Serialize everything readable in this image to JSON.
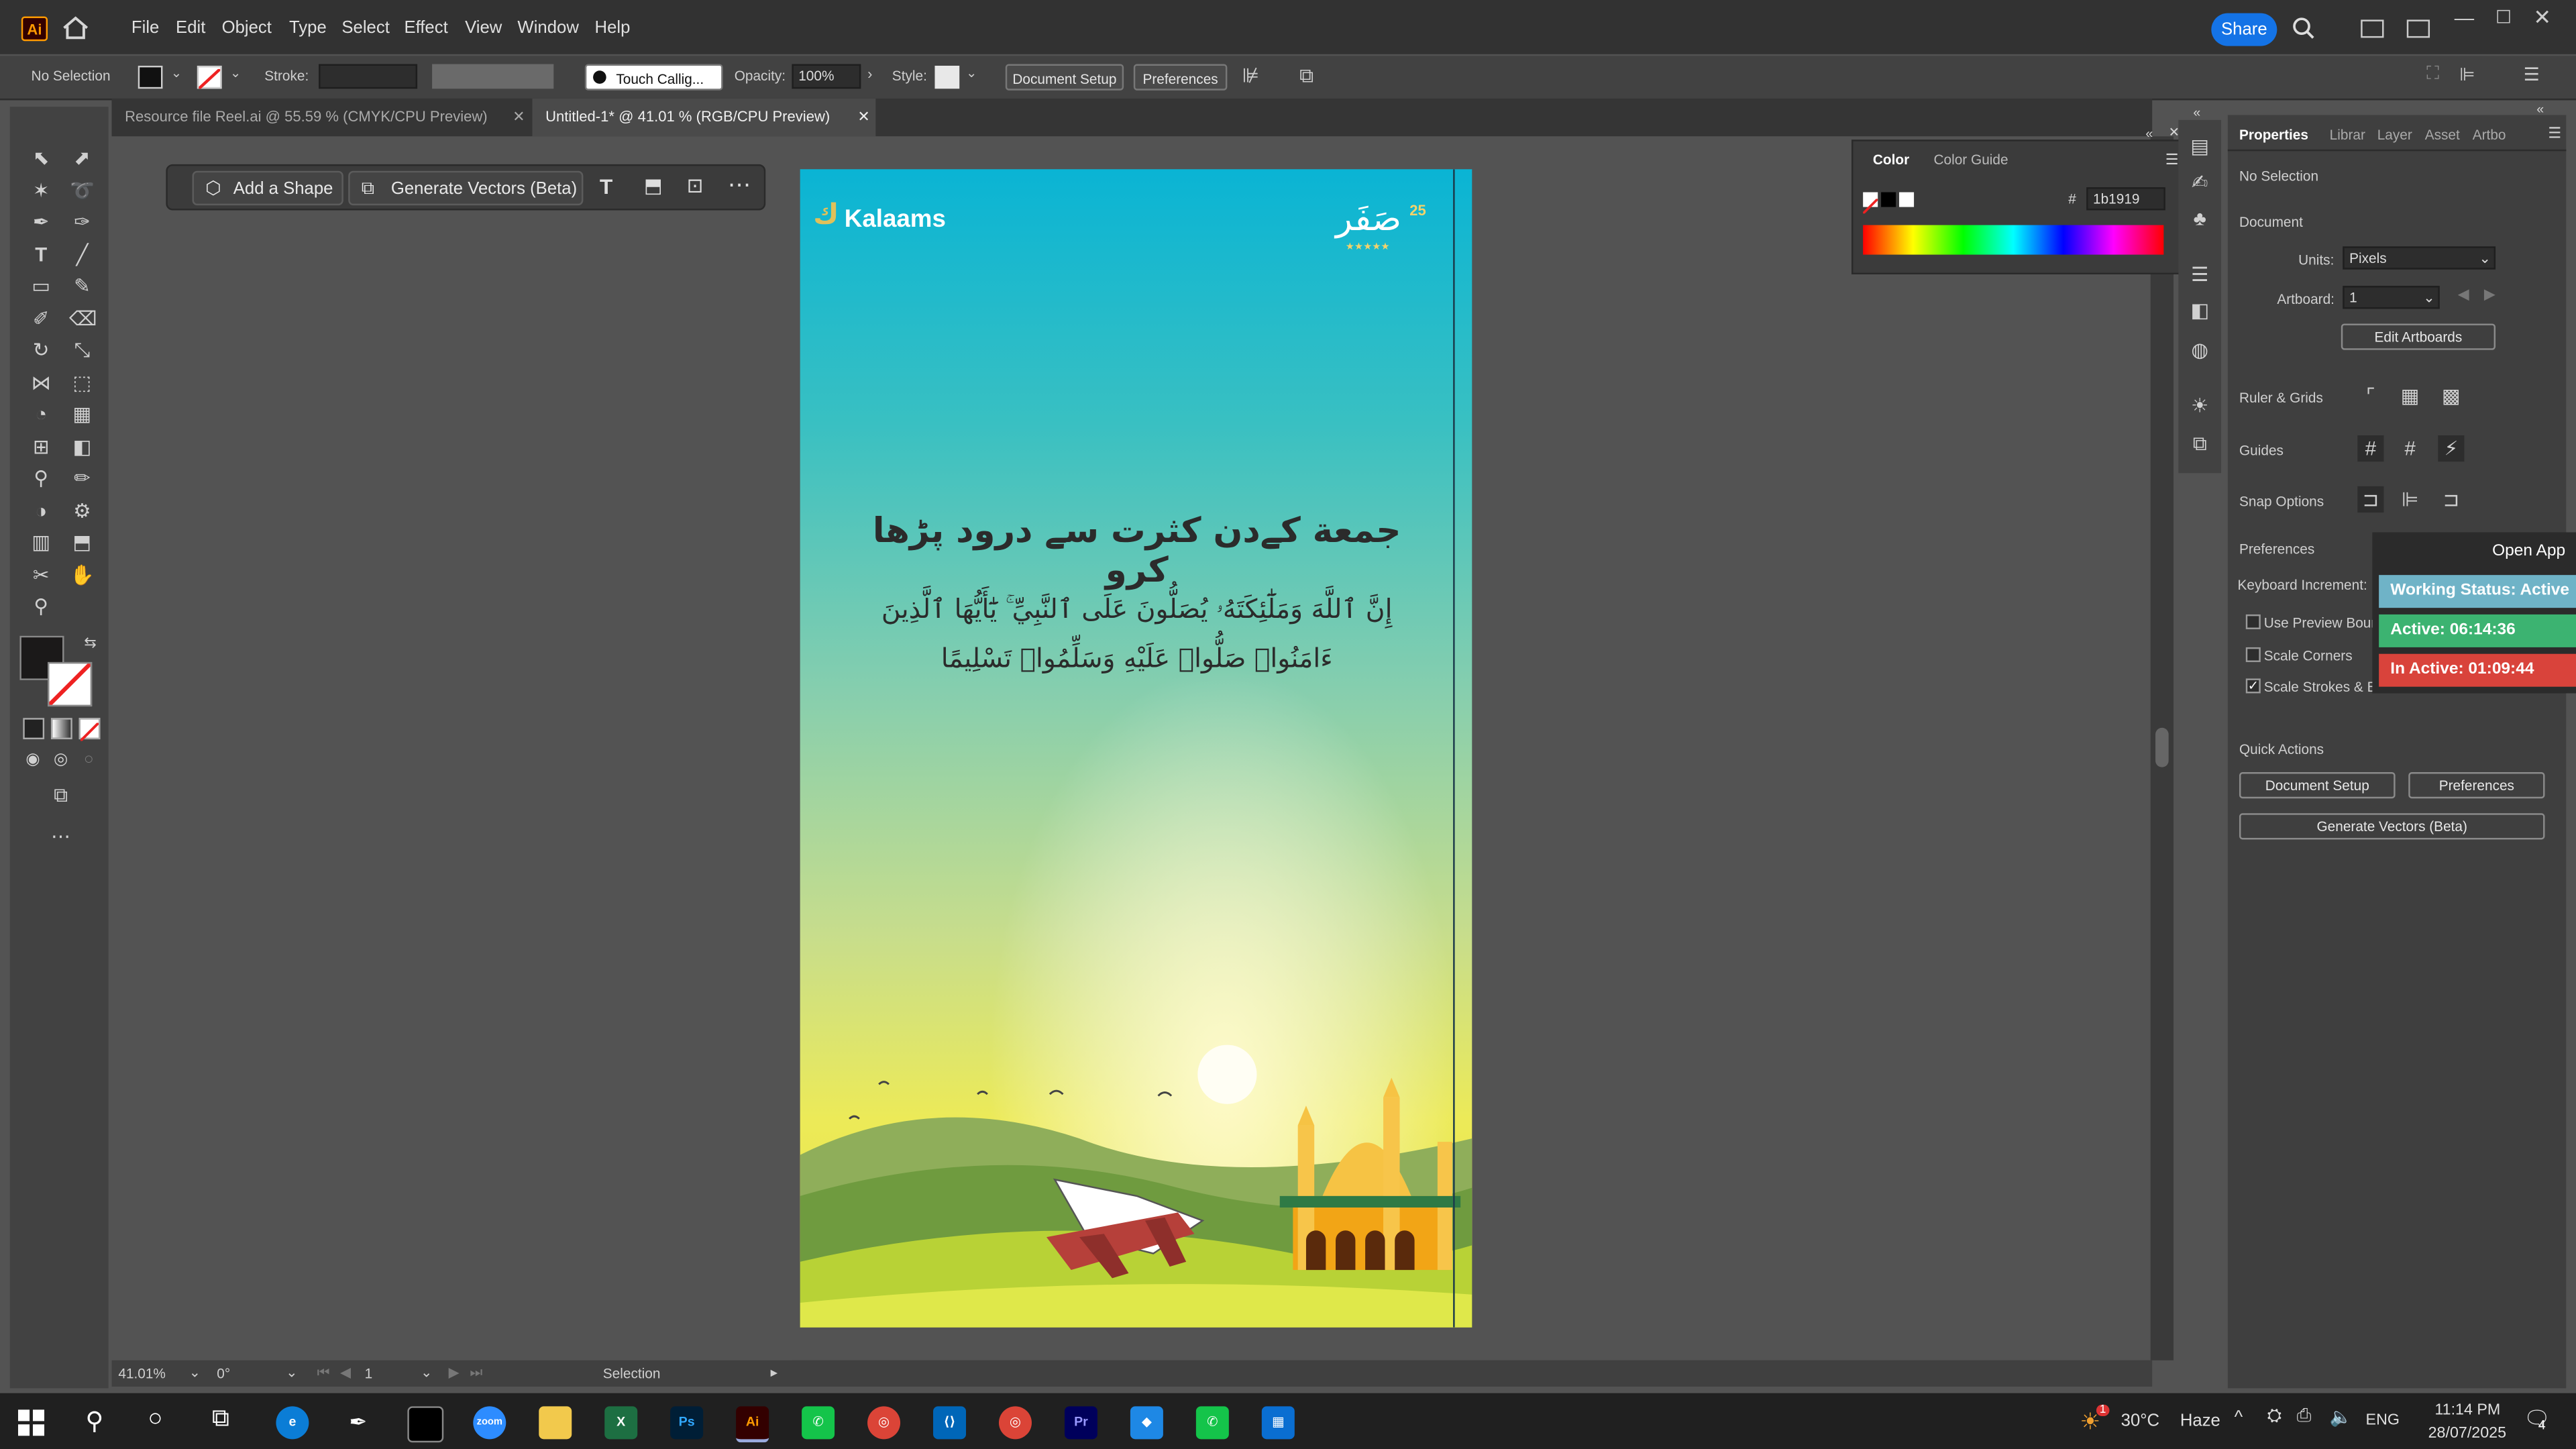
{
  "app": {
    "logo": "Ai",
    "menu": [
      "File",
      "Edit",
      "Object",
      "Type",
      "Select",
      "Effect",
      "View",
      "Window",
      "Help"
    ],
    "share_label": "Share",
    "window_controls": [
      "minimize",
      "restore",
      "close"
    ]
  },
  "control_bar": {
    "selection": "No Selection",
    "stroke_label": "Stroke:",
    "brush": "Touch Callig...",
    "opacity_label": "Opacity:",
    "opacity_value": "100%",
    "style_label": "Style:",
    "document_setup": "Document Setup",
    "preferences": "Preferences"
  },
  "tabs": [
    {
      "label": "Resource file Reel.ai @ 55.59 % (CMYK/CPU Preview)",
      "active": false
    },
    {
      "label": "Untitled-1* @ 41.01 % (RGB/CPU Preview)",
      "active": true
    }
  ],
  "context_bar": {
    "add_shape": "Add a Shape",
    "generate_vectors": "Generate Vectors (Beta)"
  },
  "artboard": {
    "brand": "Kalaams",
    "badge_number": "25",
    "urdu_heading": "جمعة کےدن کثرت سے درود پڑھا کرو",
    "arabic_line1": "إِنَّ ٱللَّهَ وَمَلَٰٓئِكَتَهُۥ يُصَلُّونَ عَلَى ٱلنَّبِيِّ ۚ يَٰٓأَيُّهَا ٱلَّذِينَ",
    "arabic_line2": "ءَامَنُوا۟ صَلُّوا۟ عَلَيْهِ وَسَلِّمُوا۟ تَسْلِيمًا"
  },
  "color_panel": {
    "tabs": [
      "Color",
      "Color Guide"
    ],
    "hash": "#",
    "hex_value": "1b1919"
  },
  "properties_panel": {
    "tabs": [
      "Properties",
      "Librar",
      "Layer",
      "Asset",
      "Artbo"
    ],
    "selection": "No Selection",
    "document_label": "Document",
    "units_label": "Units:",
    "units_value": "Pixels",
    "artboard_label": "Artboard:",
    "artboard_value": "1",
    "edit_artboards": "Edit Artboards",
    "ruler_grids": "Ruler & Grids",
    "guides": "Guides",
    "snap_options": "Snap Options",
    "preferences": "Preferences",
    "keyboard_increment": "Keyboard Increment:",
    "use_preview_bounds": "Use Preview Bounds",
    "scale_corners": "Scale Corners",
    "scale_strokes": "Scale Strokes & Effects",
    "quick_actions": "Quick Actions",
    "qa_document_setup": "Document Setup",
    "qa_preferences": "Preferences",
    "qa_generate_vectors": "Generate Vectors (Beta)"
  },
  "status_widget": {
    "open_app": "Open App",
    "working_status": "Working Status: Active",
    "active": "Active: 06:14:36",
    "inactive": "In Active: 01:09:44"
  },
  "status_bar": {
    "zoom": "41.01%",
    "rotation": "0°",
    "artboard_nav": "1",
    "tool_name": "Selection"
  },
  "taskbar": {
    "weather_temp": "30°C",
    "weather_desc": "Haze",
    "lang": "ENG",
    "time": "11:14 PM",
    "date": "28/07/2025",
    "notification_count": "4",
    "weather_badge": "1"
  },
  "colors": {
    "accent": "#1473e6",
    "working": "#6fb3c7",
    "active": "#3cb371",
    "inactive": "#d9433b"
  }
}
